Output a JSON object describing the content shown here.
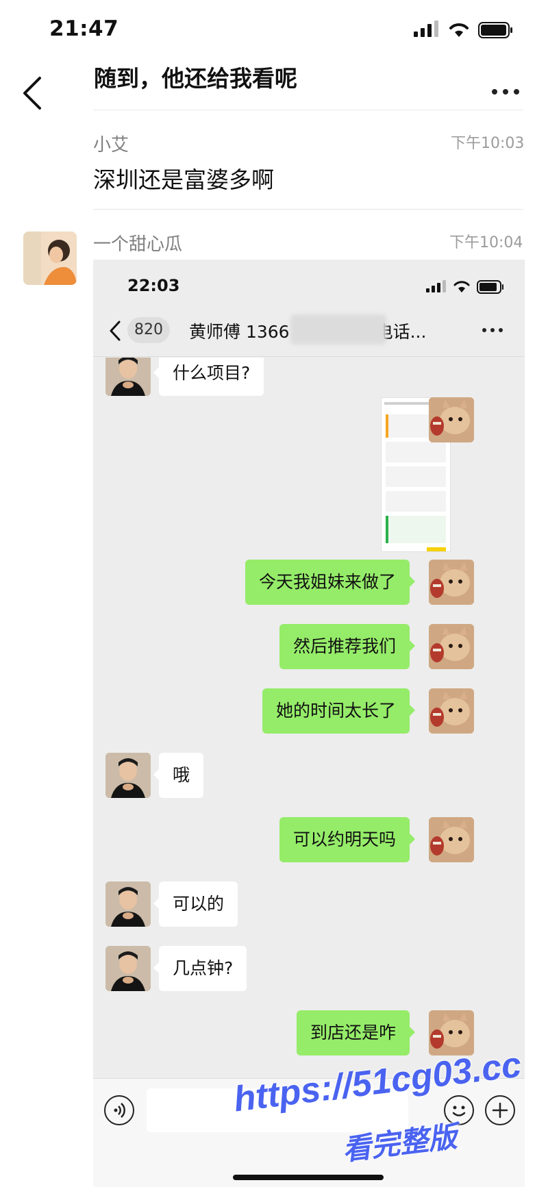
{
  "status_bar": {
    "time": "21:47"
  },
  "header": {
    "title": "随到，他还给我看呢"
  },
  "messages": [
    {
      "sender": "小艾",
      "time": "下午10:03",
      "text": "深圳还是富婆多啊"
    },
    {
      "sender": "一个甜心瓜",
      "time": "下午10:04"
    }
  ],
  "screenshot": {
    "status_time": "22:03",
    "unread_count": "820",
    "title_prefix": "黄师傅 1366",
    "title_suffix": "电话...",
    "chat": [
      {
        "from": "other",
        "text": "什么项目?"
      },
      {
        "from": "self",
        "type": "image"
      },
      {
        "from": "self",
        "text": "今天我姐妹来做了"
      },
      {
        "from": "self",
        "text": "然后推荐我们"
      },
      {
        "from": "self",
        "text": "她的时间太长了"
      },
      {
        "from": "other",
        "text": "哦"
      },
      {
        "from": "self",
        "text": "可以约明天吗"
      },
      {
        "from": "other",
        "text": "可以的"
      },
      {
        "from": "other",
        "text": "几点钟?"
      },
      {
        "from": "self",
        "text": "到店还是咋"
      }
    ]
  },
  "watermark": {
    "url": "https://51cg03.cc",
    "subtitle": "看完整版"
  },
  "colors": {
    "self_bubble": "#95ec69",
    "other_bubble": "#ffffff",
    "chat_bg": "#ededed",
    "watermark": "#4a63f0"
  }
}
